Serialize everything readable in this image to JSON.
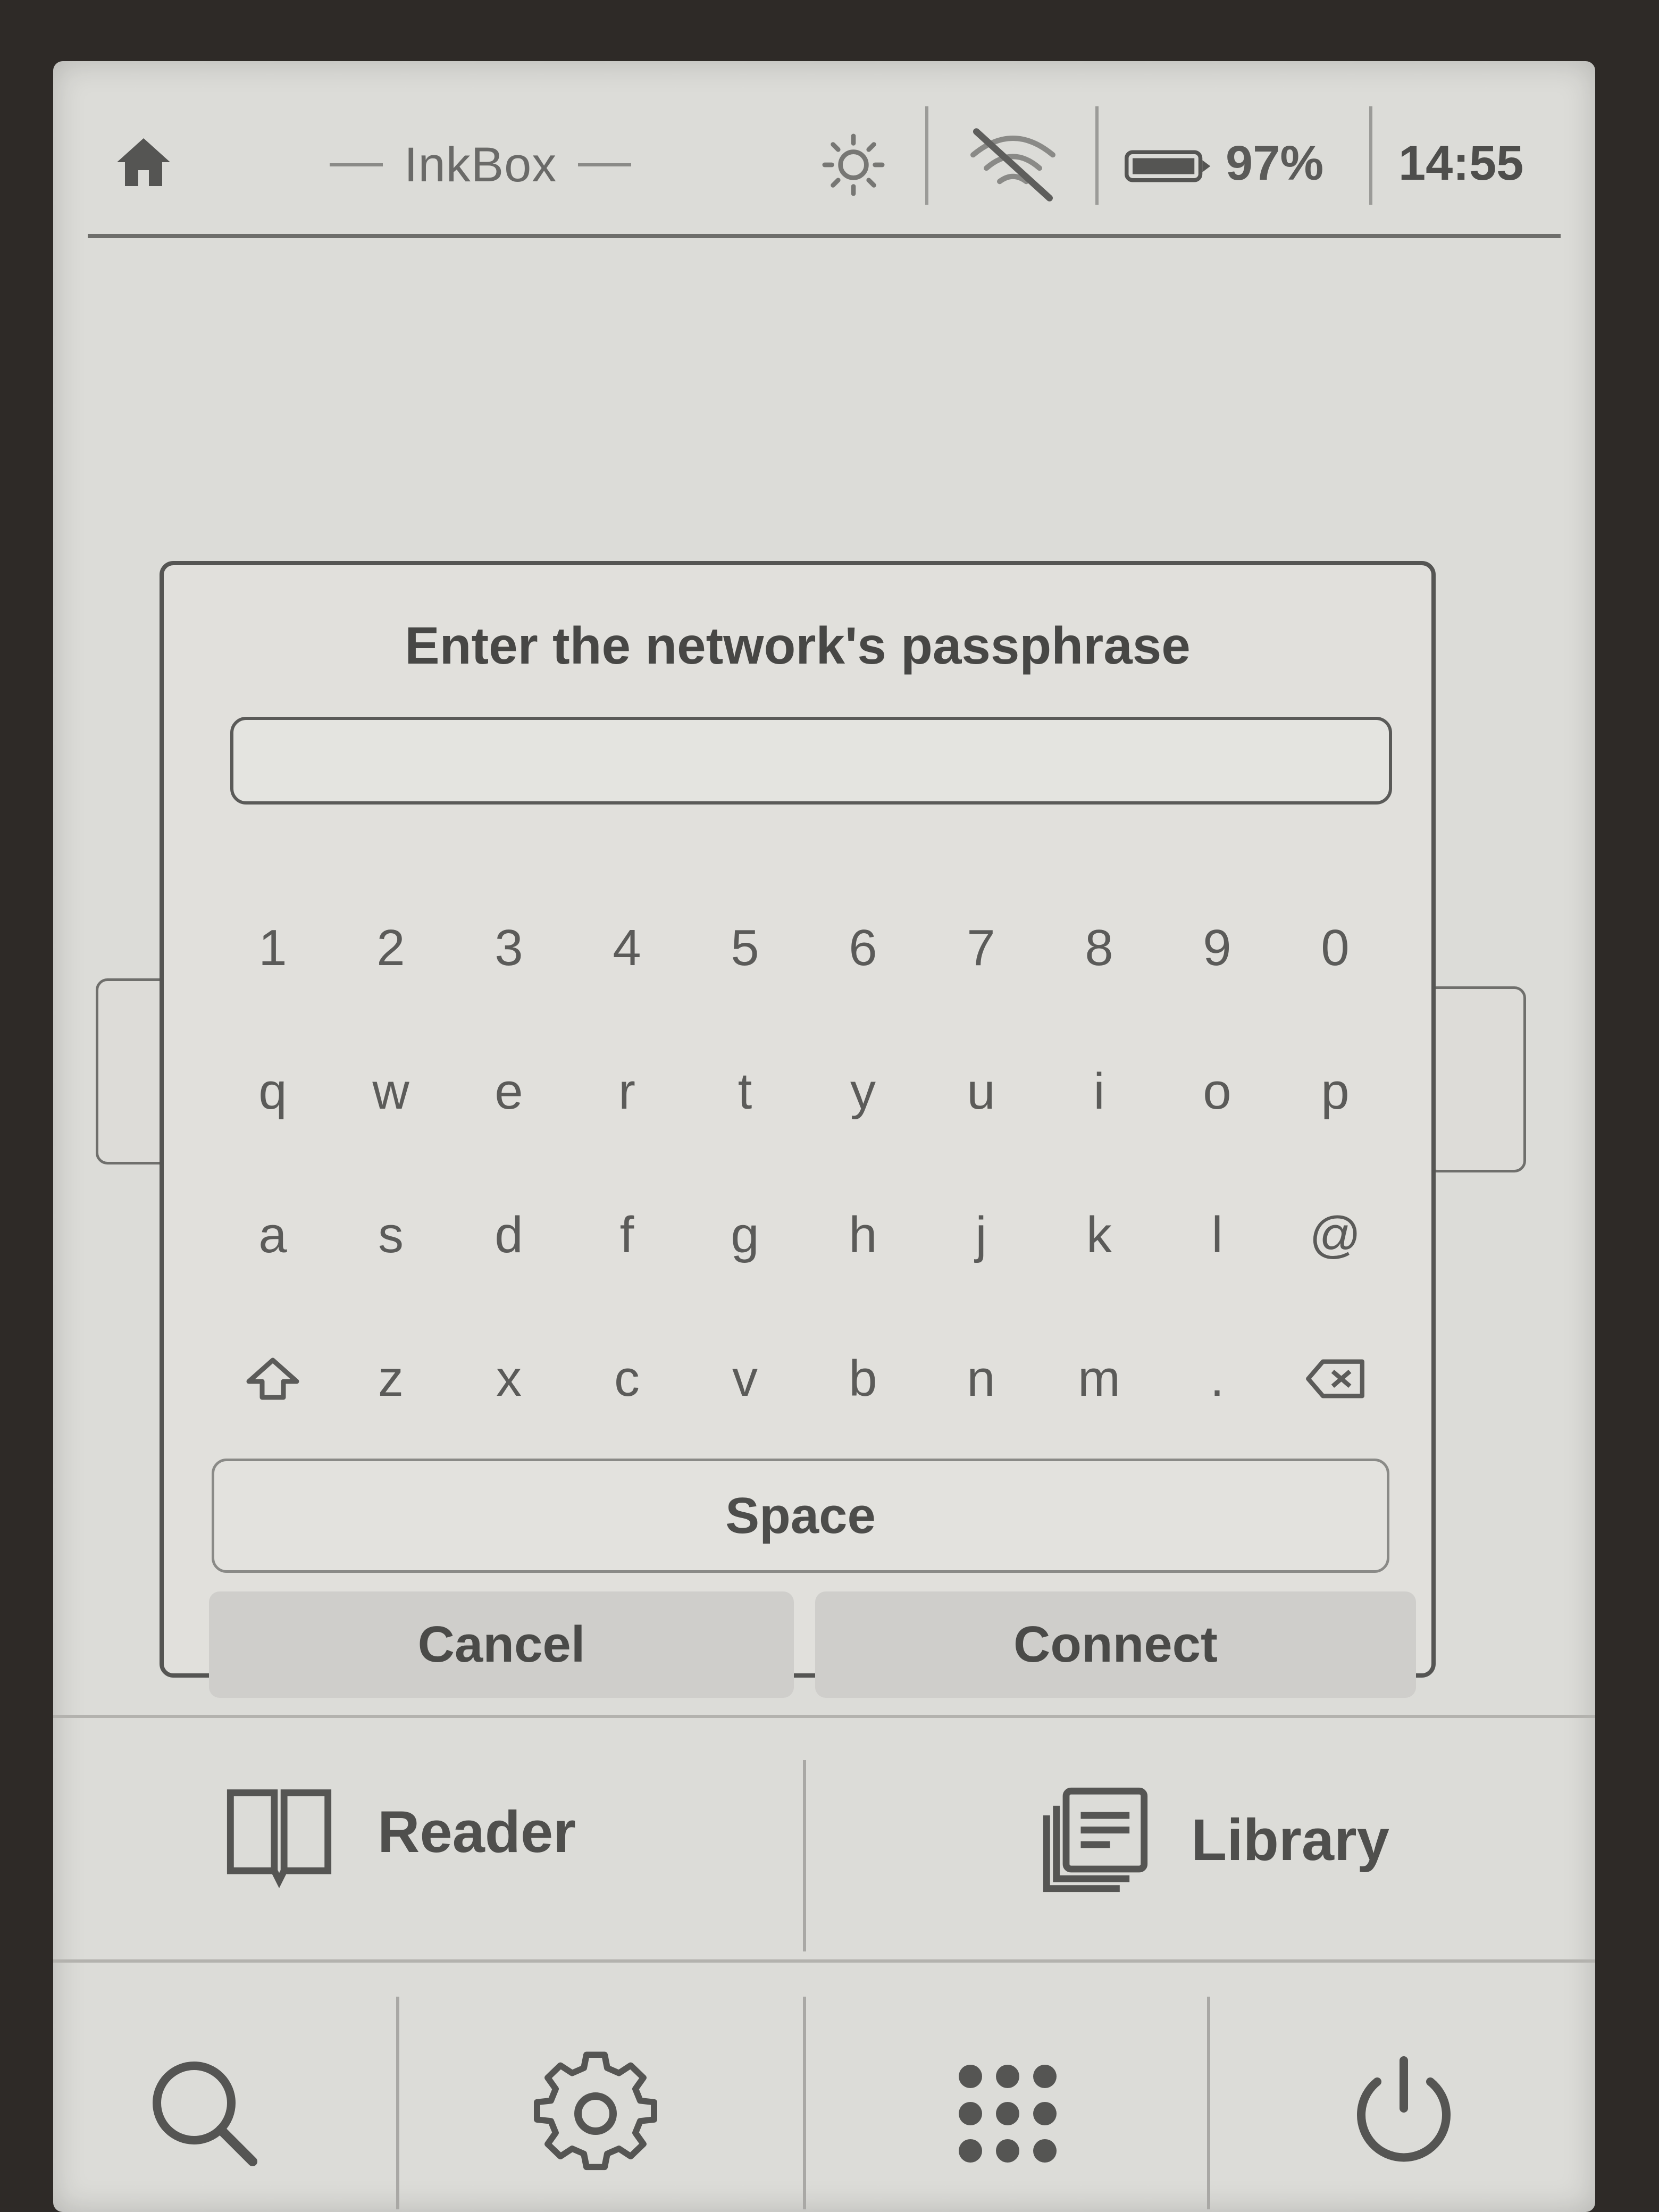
{
  "status_bar": {
    "title": "InkBox",
    "battery": "97%",
    "time": "14:55",
    "icons": [
      "home-icon",
      "brightness-icon",
      "wifi-off-icon",
      "battery-icon"
    ]
  },
  "dialog": {
    "title": "Enter the network's passphrase",
    "input_value": "",
    "keyboard": {
      "row1": [
        "1",
        "2",
        "3",
        "4",
        "5",
        "6",
        "7",
        "8",
        "9",
        "0"
      ],
      "row2": [
        "q",
        "w",
        "e",
        "r",
        "t",
        "y",
        "u",
        "i",
        "o",
        "p"
      ],
      "row3": [
        "a",
        "s",
        "d",
        "f",
        "g",
        "h",
        "j",
        "k",
        "l",
        "@"
      ],
      "row4": [
        "shift-icon",
        "z",
        "x",
        "c",
        "v",
        "b",
        "n",
        "m",
        ".",
        "backspace-icon"
      ]
    },
    "space_label": "Space",
    "cancel_label": "Cancel",
    "connect_label": "Connect"
  },
  "main_buttons": {
    "reader_label": "Reader",
    "library_label": "Library"
  },
  "toolbar": {
    "icons": [
      "search-icon",
      "settings-gear-icon",
      "apps-grid-icon",
      "power-icon"
    ]
  }
}
